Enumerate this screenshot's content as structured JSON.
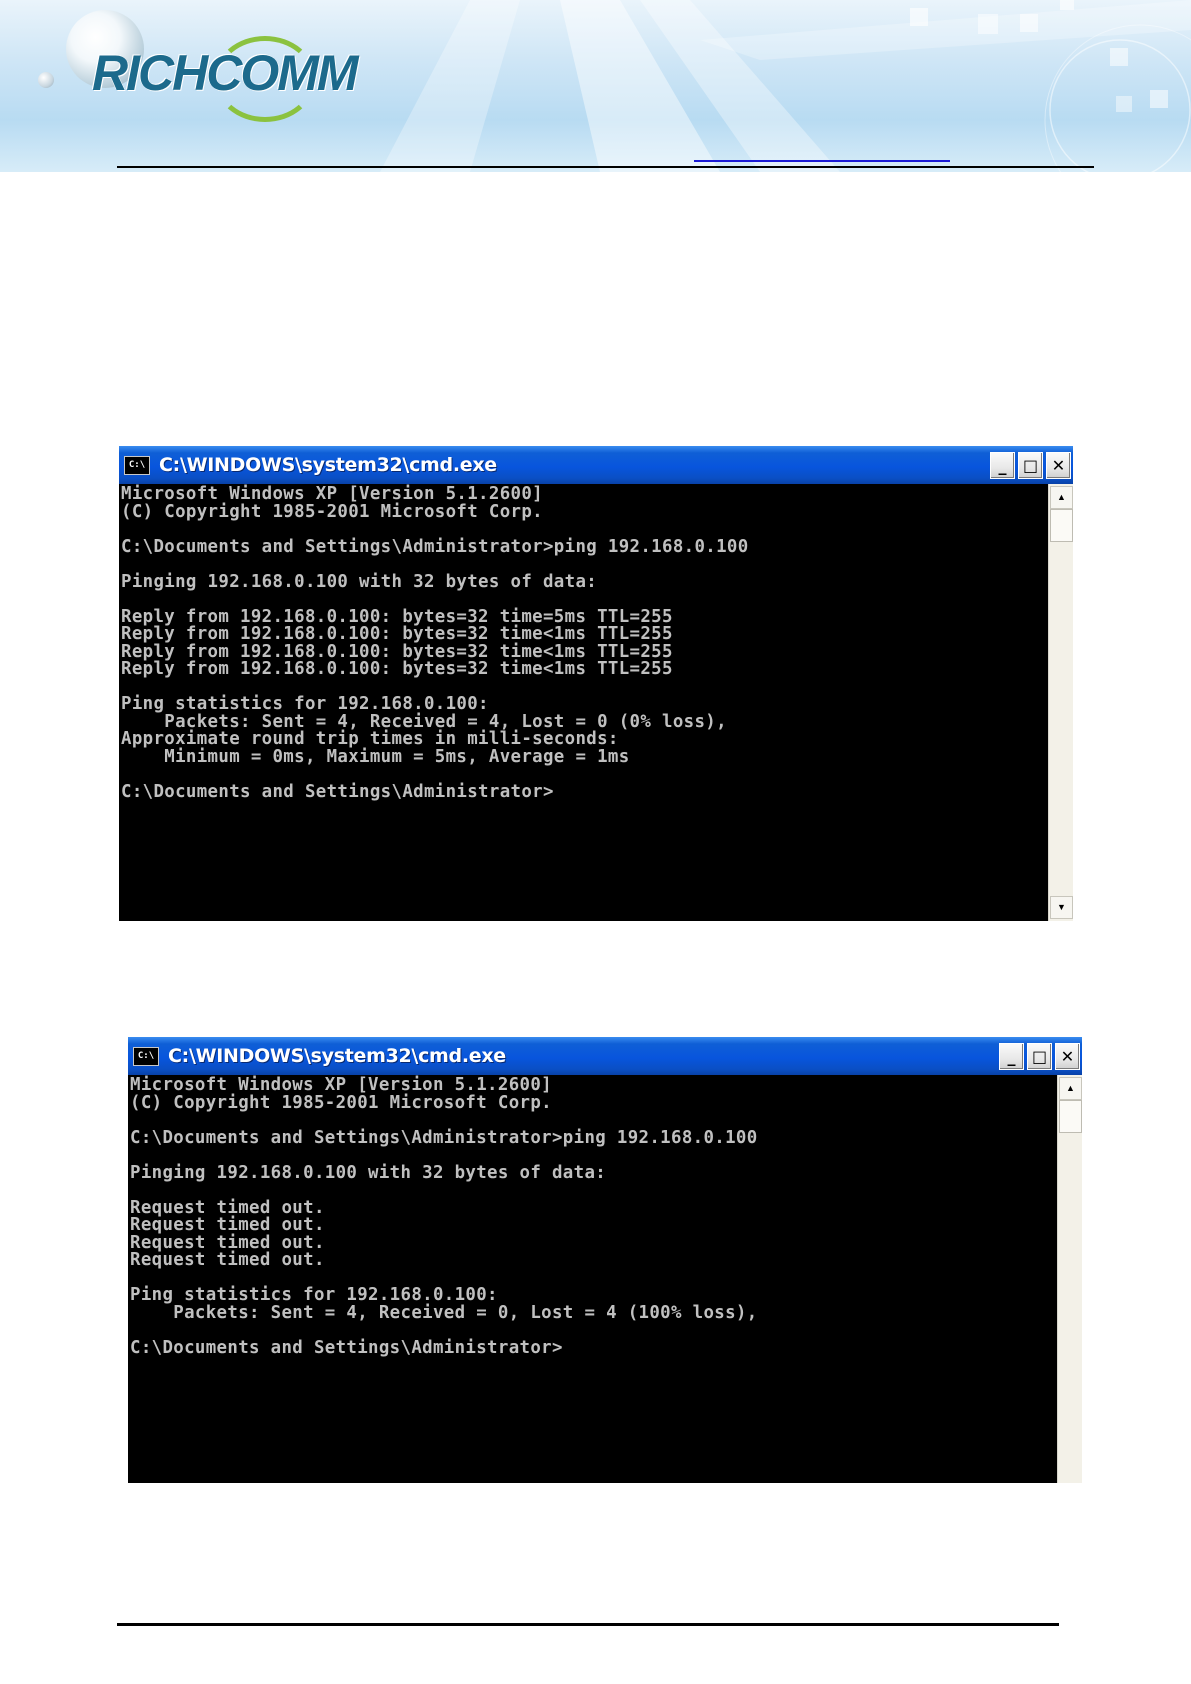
{
  "header": {
    "logo_text": "RICHCOMM",
    "logo_icon": "globe-icon"
  },
  "windows": [
    {
      "title": "C:\\WINDOWS\\system32\\cmd.exe",
      "icon_label": "C:\\",
      "controls": {
        "minimize": "_",
        "maximize": "□",
        "close": "✕"
      },
      "console_text": "Microsoft Windows XP [Version 5.1.2600]\n(C) Copyright 1985-2001 Microsoft Corp.\n\nC:\\Documents and Settings\\Administrator>ping 192.168.0.100\n\nPinging 192.168.0.100 with 32 bytes of data:\n\nReply from 192.168.0.100: bytes=32 time=5ms TTL=255\nReply from 192.168.0.100: bytes=32 time<1ms TTL=255\nReply from 192.168.0.100: bytes=32 time<1ms TTL=255\nReply from 192.168.0.100: bytes=32 time<1ms TTL=255\n\nPing statistics for 192.168.0.100:\n    Packets: Sent = 4, Received = 4, Lost = 0 (0% loss),\nApproximate round trip times in milli-seconds:\n    Minimum = 0ms, Maximum = 5ms, Average = 1ms\n\nC:\\Documents and Settings\\Administrator>",
      "scroll": {
        "up": "▲",
        "down": "▼"
      }
    },
    {
      "title": "C:\\WINDOWS\\system32\\cmd.exe",
      "icon_label": "C:\\",
      "controls": {
        "minimize": "_",
        "maximize": "□",
        "close": "✕"
      },
      "console_text": "Microsoft Windows XP [Version 5.1.2600]\n(C) Copyright 1985-2001 Microsoft Corp.\n\nC:\\Documents and Settings\\Administrator>ping 192.168.0.100\n\nPinging 192.168.0.100 with 32 bytes of data:\n\nRequest timed out.\nRequest timed out.\nRequest timed out.\nRequest timed out.\n\nPing statistics for 192.168.0.100:\n    Packets: Sent = 4, Received = 0, Lost = 4 (100% loss),\n\nC:\\Documents and Settings\\Administrator>",
      "scroll": {
        "up": "▲"
      }
    }
  ],
  "colors": {
    "titlebar": "#0855dd",
    "console_bg": "#000000",
    "console_text": "#c0c0c0",
    "logo_text": "#1c6a8c",
    "logo_swoosh": "#8bc23f"
  }
}
